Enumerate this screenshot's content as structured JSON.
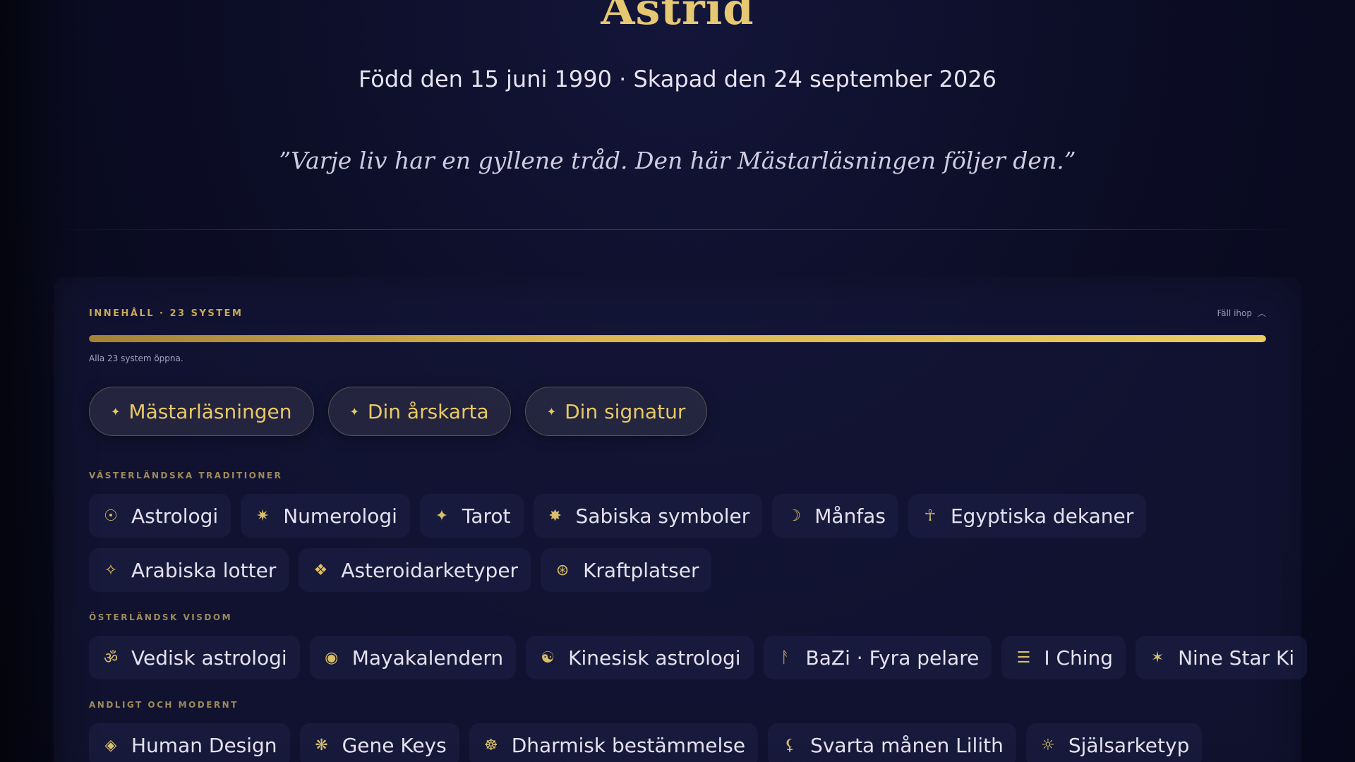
{
  "hero": {
    "name": "Astrid",
    "dates": "Född den 15 juni 1990 · Skapad den 24 september 2026",
    "quote": "”Varje liv har en gyllene tråd. Den här Mästarläsningen följer den.”"
  },
  "toc": {
    "header": "INNEHÅLL · 23 SYSTEM",
    "collapse_label": "Fäll ihop",
    "progress_percent": 100,
    "progress_note": "Alla 23 system öppna."
  },
  "features": [
    {
      "label": "Mästarläsningen",
      "icon": "sparkle-icon"
    },
    {
      "label": "Din årskarta",
      "icon": "sparkle-icon"
    },
    {
      "label": "Din signatur",
      "icon": "sparkle-icon"
    }
  ],
  "groups": [
    {
      "label": "VÄSTERLÄNDSKA TRADITIONER",
      "rows": [
        [
          {
            "label": "Astrologi",
            "icon": "sun-circle-icon",
            "glyph": "☉"
          },
          {
            "label": "Numerologi",
            "icon": "asterisk-star-icon",
            "glyph": "✷"
          },
          {
            "label": "Tarot",
            "icon": "four-point-star-icon",
            "glyph": "✦"
          },
          {
            "label": "Sabiska symboler",
            "icon": "burst-icon",
            "glyph": "✸"
          },
          {
            "label": "Månfas",
            "icon": "crescent-moon-icon",
            "glyph": "☽"
          },
          {
            "label": "Egyptiska dekaner",
            "icon": "ankh-icon",
            "glyph": "☥"
          }
        ],
        [
          {
            "label": "Arabiska lotter",
            "icon": "diamond-star-icon",
            "glyph": "✧"
          },
          {
            "label": "Asteroidarketyper",
            "icon": "four-diamonds-icon",
            "glyph": "❖"
          },
          {
            "label": "Kraftplatser",
            "icon": "compass-icon",
            "glyph": "⊛"
          }
        ]
      ]
    },
    {
      "label": "ÖSTERLÄNDSK VISDOM",
      "rows": [
        [
          {
            "label": "Vedisk astrologi",
            "icon": "om-icon",
            "glyph": "ॐ"
          },
          {
            "label": "Mayakalendern",
            "icon": "sun-disc-icon",
            "glyph": "◉"
          },
          {
            "label": "Kinesisk astrologi",
            "icon": "yin-yang-icon",
            "glyph": "☯"
          },
          {
            "label": "BaZi · Fyra pelare",
            "icon": "pillar-icon",
            "glyph": "ᚨ"
          },
          {
            "label": "I Ching",
            "icon": "trigram-icon",
            "glyph": "☰"
          },
          {
            "label": "Nine Star Ki",
            "icon": "star-icon",
            "glyph": "✶"
          }
        ]
      ]
    },
    {
      "label": "ANDLIGT OCH MODERNT",
      "rows": [
        [
          {
            "label": "Human Design",
            "icon": "diamond-icon",
            "glyph": "◈"
          },
          {
            "label": "Gene Keys",
            "icon": "snowflake-icon",
            "glyph": "❋"
          },
          {
            "label": "Dharmisk bestämmelse",
            "icon": "wheel-icon",
            "glyph": "☸"
          },
          {
            "label": "Svarta månen Lilith",
            "icon": "lilith-icon",
            "glyph": "⚸"
          },
          {
            "label": "Själsarketyp",
            "icon": "sun-rays-icon",
            "glyph": "☼"
          }
        ]
      ]
    }
  ],
  "colors": {
    "gold": "#e8c964",
    "background": "#0c0d26",
    "text": "#e4e1ee"
  }
}
